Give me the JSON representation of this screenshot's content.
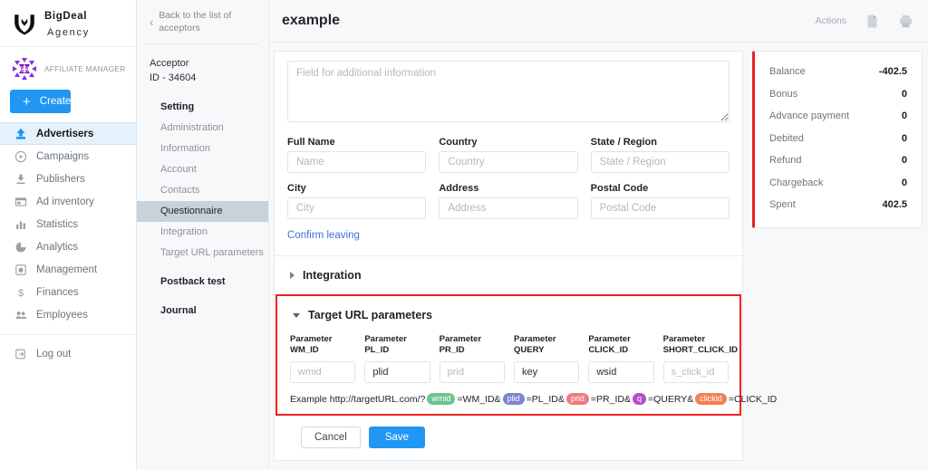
{
  "brand": {
    "line1": "BigDeal",
    "line2": "Agency",
    "logo_icon": "shield-logo-icon"
  },
  "sidebar": {
    "manager_label": "AFFILIATE MANAGER",
    "manager_avatar_icon": "identicon-avatar",
    "create_label": "Create",
    "create_plus": "+",
    "accent_color": "#2196f3",
    "items": [
      {
        "label": "Advertisers",
        "icon": "upload-icon",
        "active": true
      },
      {
        "label": "Campaigns",
        "icon": "play-circle-icon",
        "active": false
      },
      {
        "label": "Publishers",
        "icon": "download-icon",
        "active": false
      },
      {
        "label": "Ad inventory",
        "icon": "window-icon",
        "active": false
      },
      {
        "label": "Statistics",
        "icon": "bar-chart-icon",
        "active": false
      },
      {
        "label": "Analytics",
        "icon": "pie-chart-icon",
        "active": false
      },
      {
        "label": "Management",
        "icon": "settings-box-icon",
        "active": false
      },
      {
        "label": "Finances",
        "icon": "dollar-icon",
        "active": false
      },
      {
        "label": "Employees",
        "icon": "people-icon",
        "active": false
      }
    ],
    "logout": {
      "label": "Log out",
      "icon": "logout-icon"
    }
  },
  "subnav": {
    "back_label": "Back to the list of acceptors",
    "back_icon": "chevron-left-icon",
    "acceptor_line1": "Acceptor",
    "acceptor_line2": "ID - 34604",
    "items": [
      {
        "label": "Setting",
        "style": "head",
        "selected": false
      },
      {
        "label": "Administration",
        "style": "child",
        "selected": false
      },
      {
        "label": "Information",
        "style": "child",
        "selected": false
      },
      {
        "label": "Account",
        "style": "child",
        "selected": false
      },
      {
        "label": "Contacts",
        "style": "child",
        "selected": false
      },
      {
        "label": "Questionnaire",
        "style": "child",
        "selected": true
      },
      {
        "label": "Integration",
        "style": "child",
        "selected": false
      },
      {
        "label": "Target URL parameters",
        "style": "child",
        "selected": false
      },
      {
        "label": "Postback test",
        "style": "head-gap",
        "selected": false
      },
      {
        "label": "Journal",
        "style": "head-gap",
        "selected": false
      }
    ]
  },
  "topbar": {
    "title": "example",
    "actions_label": "Actions",
    "document_icon": "document-icon",
    "print_icon": "printer-icon"
  },
  "questionnaire": {
    "note_placeholder": "Field for additional information",
    "note_value": "",
    "fields": [
      {
        "label": "Full Name",
        "placeholder": "Name",
        "value": ""
      },
      {
        "label": "Country",
        "placeholder": "Country",
        "value": ""
      },
      {
        "label": "State / Region",
        "placeholder": "State / Region",
        "value": ""
      },
      {
        "label": "City",
        "placeholder": "City",
        "value": ""
      },
      {
        "label": "Address",
        "placeholder": "Address",
        "value": ""
      },
      {
        "label": "Postal Code",
        "placeholder": "Postal Code",
        "value": ""
      }
    ],
    "confirm_link": "Confirm leaving"
  },
  "integration_section": {
    "title": "Integration",
    "expanded": false,
    "caret_icon": "caret-right-icon"
  },
  "target_url_section": {
    "title": "Target URL parameters",
    "expanded": true,
    "caret_icon": "caret-down-icon",
    "highlight_color": "#ef2020",
    "param_label": "Parameter",
    "parameters": [
      {
        "name": "WM_ID",
        "placeholder": "wmid",
        "value": ""
      },
      {
        "name": "PL_ID",
        "placeholder": "plid",
        "value": "plid"
      },
      {
        "name": "PR_ID",
        "placeholder": "prid",
        "value": ""
      },
      {
        "name": "QUERY",
        "placeholder": "key",
        "value": "key"
      },
      {
        "name": "CLICK_ID",
        "placeholder": "wsid",
        "value": "wsid"
      },
      {
        "name": "SHORT_CLICK_ID",
        "placeholder": "s_click_id",
        "value": ""
      }
    ],
    "example_prefix": "Example http://targetURL.com/?",
    "example_tokens": [
      {
        "chip": "wmid",
        "color": "#6cc48f",
        "text": "=WM_ID&"
      },
      {
        "chip": "plid",
        "color": "#7b85cf",
        "text": "=PL_ID&"
      },
      {
        "chip": "prid",
        "color": "#ef7b81",
        "text": "=PR_ID&"
      },
      {
        "chip": "q",
        "color": "#b24fc6",
        "text": "=QUERY&"
      },
      {
        "chip": "clickid",
        "color": "#f4804f",
        "text": "=CLICK_ID"
      }
    ]
  },
  "footer": {
    "cancel_label": "Cancel",
    "save_label": "Save"
  },
  "balance_panel": {
    "accent_color": "#ef2020",
    "rows": [
      {
        "label": "Balance",
        "value": "-402.5"
      },
      {
        "label": "Bonus",
        "value": "0"
      },
      {
        "label": "Advance payment",
        "value": "0"
      },
      {
        "label": "Debited",
        "value": "0"
      },
      {
        "label": "Refund",
        "value": "0"
      },
      {
        "label": "Chargeback",
        "value": "0"
      },
      {
        "label": "Spent",
        "value": "402.5"
      }
    ]
  }
}
